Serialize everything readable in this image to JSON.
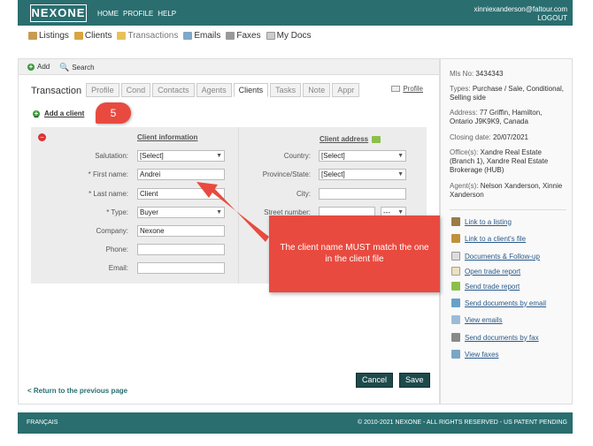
{
  "header": {
    "logo": "NEXONE",
    "nav": [
      "HOME",
      "PROFILE",
      "HELP"
    ],
    "user_email": "xinniexanderson@faltour.com",
    "logout": "LOGOUT"
  },
  "secnav": [
    {
      "label": "Listings",
      "icon": "house-icon"
    },
    {
      "label": "Clients",
      "icon": "people-icon"
    },
    {
      "label": "Transactions",
      "icon": "folder-icon"
    },
    {
      "label": "Emails",
      "icon": "envelope-icon"
    },
    {
      "label": "Faxes",
      "icon": "fax-icon"
    },
    {
      "label": "My Docs",
      "icon": "document-icon"
    }
  ],
  "toolbar": {
    "add": "Add",
    "search": "Search"
  },
  "tabs": {
    "section_label": "Transaction",
    "items": [
      "Profile",
      "Cond",
      "Contacts",
      "Agents",
      "Clients",
      "Tasks",
      "Note",
      "Appr"
    ],
    "active": "Clients",
    "profile_link": "Profile"
  },
  "add_client": "Add a client",
  "client_info": {
    "title": "Client information",
    "salutation_label": "Salutation:",
    "salutation_value": "[Select]",
    "first_name_label": "* First name:",
    "first_name_value": "Andrei",
    "last_name_label": "* Last name:",
    "last_name_value": "Client",
    "type_label": "* Type:",
    "type_value": "Buyer",
    "company_label": "Company:",
    "company_value": "Nexone",
    "phone_label": "Phone:",
    "email_label": "Email:"
  },
  "client_address": {
    "title": "Client address",
    "country_label": "Country:",
    "country_value": "[Select]",
    "province_label": "Province/State:",
    "province_value": "[Select]",
    "city_label": "City:",
    "street_label": "Street number:",
    "street_suffix_value": "---"
  },
  "buttons": {
    "cancel": "Cancel",
    "save": "Save"
  },
  "back_link": "< Return to the previous page",
  "sidebar": {
    "mls_label": "Mls No:",
    "mls_value": "3434343",
    "types_label": "Types:",
    "types_value": "Purchase / Sale, Conditional, Selling side",
    "address_label": "Address:",
    "address_value": "77 Griffin, Hamilton, Ontario J9K9K9, Canada",
    "closing_label": "Closing date:",
    "closing_value": "20/07/2021",
    "offices_label": "Office(s):",
    "offices_value": "Xandre Real Estate (Branch 1), Xandre Real Estate Brokerage (HUB)",
    "agents_label": "Agent(s):",
    "agents_value": "Nelson Xanderson, Xinnie Xanderson",
    "actions": [
      {
        "label": "Link to a listing",
        "icon": "house-link-icon"
      },
      {
        "label": "Link to a client's file",
        "icon": "client-link-icon"
      },
      {
        "label": "Documents & Follow-up",
        "icon": "documents-icon"
      },
      {
        "label": "Open trade report",
        "icon": "report-icon"
      },
      {
        "label": "Send trade report",
        "icon": "send-report-icon"
      },
      {
        "label": "Send documents by email",
        "icon": "email-docs-icon"
      },
      {
        "label": "View emails",
        "icon": "view-email-icon"
      },
      {
        "label": "Send documents by fax",
        "icon": "fax-docs-icon"
      },
      {
        "label": "View faxes",
        "icon": "view-fax-icon"
      }
    ]
  },
  "footer": {
    "language": "FRANÇAIS",
    "copyright": "© 2010-2021 NEXONE - ALL RIGHTS RESERVED - US PATENT PENDING"
  },
  "annotation": {
    "step": "5",
    "callout": "The client name MUST match the one in the client file"
  },
  "colors": {
    "brand": "#2a6e70",
    "annotation": "#e94a3f",
    "button": "#1e4a4c"
  }
}
